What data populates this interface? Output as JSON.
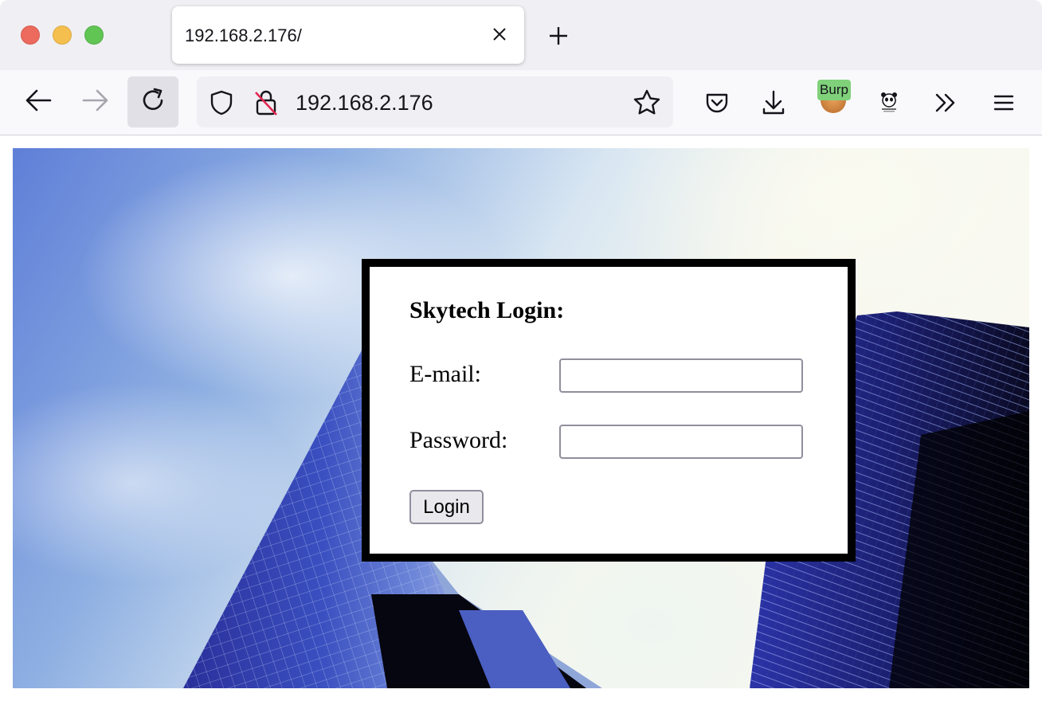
{
  "browser": {
    "tab": {
      "title": "192.168.2.176/"
    },
    "urlbar": {
      "url": "192.168.2.176"
    },
    "extensions": {
      "burp_label": "Burp"
    }
  },
  "page": {
    "login": {
      "title": "Skytech Login:",
      "email_label": "E-mail:",
      "email_value": "",
      "password_label": "Password:",
      "password_value": "",
      "button_label": "Login"
    }
  },
  "colors": {
    "login_border": "#000000",
    "tab_strip": "#f0f0f4",
    "nav_bar": "#f9f9fb"
  },
  "icons": {
    "traffic_lights": [
      "close-window-icon",
      "minimize-window-icon",
      "maximize-window-icon"
    ],
    "tab_close": "close-icon",
    "new_tab": "plus-icon",
    "back": "arrow-left-icon",
    "forward": "arrow-right-icon",
    "reload": "reload-icon",
    "tracking_protection": "shield-icon",
    "insecure": "lock-insecure-icon",
    "bookmark": "star-icon",
    "pocket": "pocket-icon",
    "downloads": "download-icon",
    "burp_extension": "burp-extension-icon",
    "panda_extension": "panda-extension-icon",
    "overflow": "chevron-double-right-icon",
    "menu": "hamburger-menu-icon"
  }
}
